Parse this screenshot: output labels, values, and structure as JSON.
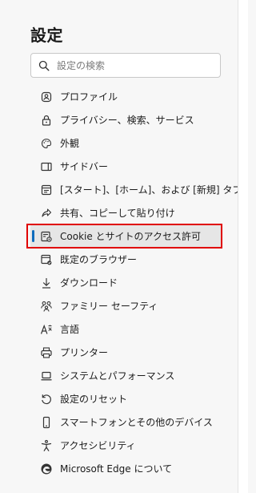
{
  "header": {
    "title": "設定"
  },
  "search": {
    "placeholder": "設定の検索"
  },
  "nav": {
    "items": [
      {
        "label": "プロファイル",
        "icon": "profile-icon"
      },
      {
        "label": "プライバシー、検索、サービス",
        "icon": "lock-icon"
      },
      {
        "label": "外観",
        "icon": "palette-icon"
      },
      {
        "label": "サイドバー",
        "icon": "sidebar-icon"
      },
      {
        "label": "[スタート]、[ホーム]、および [新規] タブ",
        "icon": "home-tab-icon"
      },
      {
        "label": "共有、コピーして貼り付け",
        "icon": "share-icon"
      },
      {
        "label": "Cookie とサイトのアクセス許可",
        "icon": "cookie-settings-icon",
        "selected": true
      },
      {
        "label": "既定のブラウザー",
        "icon": "default-browser-icon"
      },
      {
        "label": "ダウンロード",
        "icon": "download-icon"
      },
      {
        "label": "ファミリー セーフティ",
        "icon": "family-icon"
      },
      {
        "label": "言語",
        "icon": "language-icon"
      },
      {
        "label": "プリンター",
        "icon": "printer-icon"
      },
      {
        "label": "システムとパフォーマンス",
        "icon": "laptop-icon"
      },
      {
        "label": "設定のリセット",
        "icon": "reset-icon"
      },
      {
        "label": "スマートフォンとその他のデバイス",
        "icon": "phone-icon"
      },
      {
        "label": "アクセシビリティ",
        "icon": "accessibility-icon"
      },
      {
        "label": "Microsoft Edge について",
        "icon": "edge-logo-icon"
      }
    ]
  },
  "colors": {
    "accent": "#0f6cbd",
    "highlight_border": "#e00000",
    "selected_bg": "#e6e6e6"
  }
}
